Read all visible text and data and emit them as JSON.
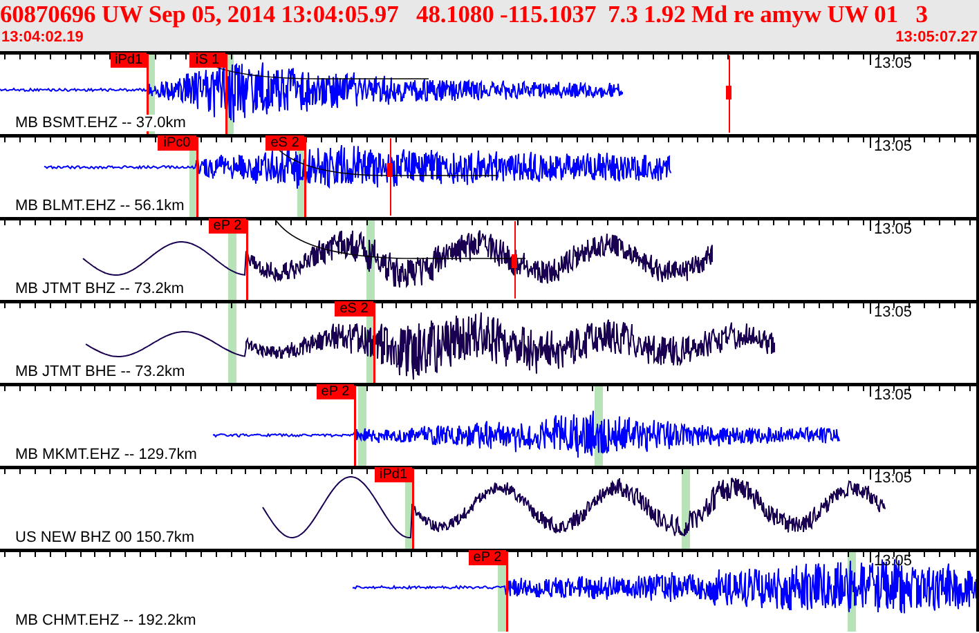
{
  "header": {
    "title": "60870696 UW Sep 05, 2014 13:04:05.97   48.1080 -115.1037  7.3 1.92 Md re amyw UW 01   3",
    "start_time": "13:04:02.19",
    "end_time": "13:05:07.27"
  },
  "traces": [
    {
      "label": "MB BSMT.EHZ -- 37.0km",
      "time_label": "13:05",
      "color": "#0000ff",
      "picks": [
        {
          "label": "iPd1"
        },
        {
          "label": "iS 1"
        }
      ]
    },
    {
      "label": "MB BLMT.EHZ -- 56.1km",
      "time_label": "13:05",
      "color": "#0000ff",
      "picks": [
        {
          "label": "iPc0"
        },
        {
          "label": "eS 2"
        }
      ]
    },
    {
      "label": "MB JTMT BHZ -- 73.2km",
      "time_label": "13:05",
      "color": "#1a0050",
      "picks": [
        {
          "label": "eP 2"
        }
      ]
    },
    {
      "label": "MB JTMT BHE -- 73.2km",
      "time_label": "13:05",
      "color": "#1a0050",
      "picks": [
        {
          "label": "eS 2"
        }
      ]
    },
    {
      "label": "MB MKMT.EHZ -- 129.7km",
      "time_label": "13:05",
      "color": "#0000ff",
      "picks": [
        {
          "label": "eP 2"
        }
      ]
    },
    {
      "label": "US NEW BHZ 00 150.7km",
      "time_label": "13:05",
      "color": "#1a0050",
      "picks": [
        {
          "label": "iPd1"
        }
      ]
    },
    {
      "label": "MB CHMT.EHZ -- 192.2km",
      "time_label": "13:05",
      "color": "#0000ff",
      "picks": [
        {
          "label": "eP 2"
        }
      ]
    }
  ]
}
